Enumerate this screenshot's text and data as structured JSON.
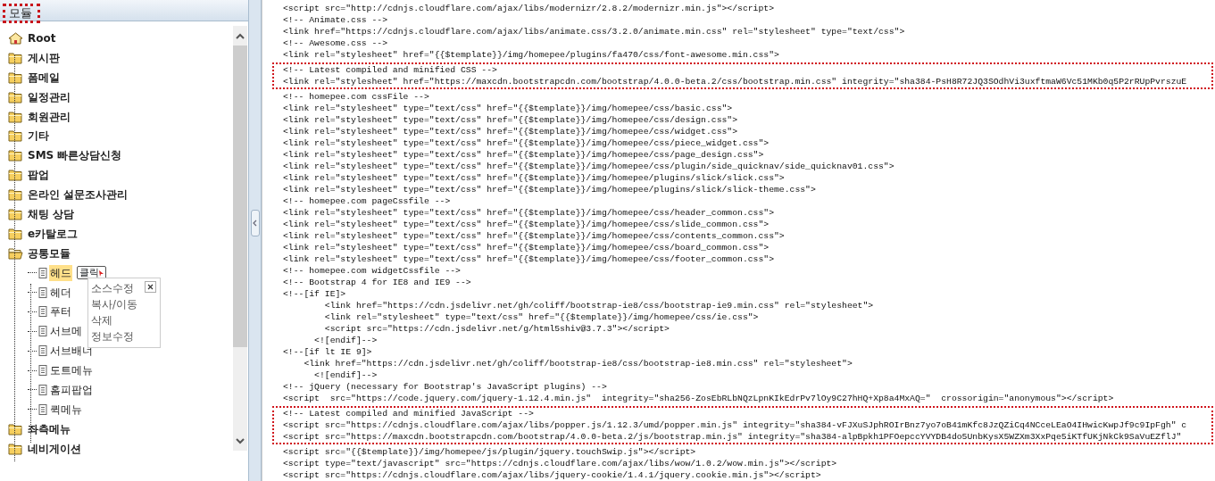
{
  "panel": {
    "title": "모듈",
    "highlighted": true
  },
  "tree": [
    {
      "label": "Root",
      "kind": "root",
      "selected": false
    },
    {
      "label": "게시판",
      "kind": "folder",
      "expanded": false,
      "selected": false
    },
    {
      "label": "폼메일",
      "kind": "folder",
      "expanded": false,
      "selected": false
    },
    {
      "label": "일정관리",
      "kind": "folder",
      "expanded": false,
      "selected": false
    },
    {
      "label": "회원관리",
      "kind": "folder",
      "expanded": false,
      "selected": false
    },
    {
      "label": "기타",
      "kind": "folder",
      "expanded": false,
      "selected": false
    },
    {
      "label": "SMS 빠른상담신청",
      "kind": "folder",
      "expanded": false,
      "selected": false
    },
    {
      "label": "팝업",
      "kind": "folder",
      "expanded": false,
      "selected": false
    },
    {
      "label": "온라인 설문조사관리",
      "kind": "folder",
      "expanded": false,
      "selected": false
    },
    {
      "label": "채팅 상담",
      "kind": "folder",
      "expanded": false,
      "selected": false
    },
    {
      "label": "e카탈로그",
      "kind": "folder",
      "expanded": false,
      "selected": false
    },
    {
      "label": "공통모듈",
      "kind": "folder",
      "expanded": true,
      "selected": false,
      "children": [
        {
          "label": "헤드",
          "kind": "page",
          "selected": true,
          "callout": "클릭"
        },
        {
          "label": "헤더",
          "kind": "page",
          "selected": false
        },
        {
          "label": "푸터",
          "kind": "page",
          "selected": false
        },
        {
          "label": "서브메",
          "kind": "page",
          "selected": false
        },
        {
          "label": "서브배너",
          "kind": "page",
          "selected": false
        },
        {
          "label": "도트메뉴",
          "kind": "page",
          "selected": false
        },
        {
          "label": "홈피팝업",
          "kind": "page",
          "selected": false
        },
        {
          "label": "퀵메뉴",
          "kind": "page",
          "selected": false
        }
      ]
    },
    {
      "label": "좌측메뉴",
      "kind": "folder",
      "expanded": false,
      "selected": false
    },
    {
      "label": "네비게이션",
      "kind": "folder",
      "expanded": false,
      "selected": false
    }
  ],
  "context_menu": {
    "items": [
      "소스수정",
      "복사/이동",
      "삭제",
      "정보수정"
    ]
  },
  "code": {
    "blocks": [
      {
        "highlighted": false,
        "lines": [
          "<script src=\"http://cdnjs.cloudflare.com/ajax/libs/modernizr/2.8.2/modernizr.min.js\"></script>",
          "<!-- Animate.css -->",
          "<link href=\"https://cdnjs.cloudflare.com/ajax/libs/animate.css/3.2.0/animate.min.css\" rel=\"stylesheet\" type=\"text/css\">",
          "<!-- Awesome.css -->",
          "<link rel=\"stylesheet\" href=\"{{$template}}/img/homepee/plugins/fa470/css/font-awesome.min.css\">"
        ]
      },
      {
        "highlighted": true,
        "lines": [
          "<!-- Latest compiled and minified CSS -->",
          "<link rel=\"stylesheet\" href=\"https://maxcdn.bootstrapcdn.com/bootstrap/4.0.0-beta.2/css/bootstrap.min.css\" integrity=\"sha384-PsH8R72JQ3SOdhVi3uxftmaW6Vc51MKb0q5P2rRUpPvrszuE"
        ]
      },
      {
        "highlighted": false,
        "lines": [
          "<!-- homepee.com cssFile -->",
          "<link rel=\"stylesheet\" type=\"text/css\" href=\"{{$template}}/img/homepee/css/basic.css\">",
          "<link rel=\"stylesheet\" type=\"text/css\" href=\"{{$template}}/img/homepee/css/design.css\">",
          "<link rel=\"stylesheet\" type=\"text/css\" href=\"{{$template}}/img/homepee/css/widget.css\">",
          "<link rel=\"stylesheet\" type=\"text/css\" href=\"{{$template}}/img/homepee/css/piece_widget.css\">",
          "<link rel=\"stylesheet\" type=\"text/css\" href=\"{{$template}}/img/homepee/css/page_design.css\">",
          "<link rel=\"stylesheet\" type=\"text/css\" href=\"{{$template}}/img/homepee/css/plugin/side_quicknav/side_quicknav01.css\">",
          "<link rel=\"stylesheet\" type=\"text/css\" href=\"{{$template}}/img/homepee/plugins/slick/slick.css\">",
          "<link rel=\"stylesheet\" type=\"text/css\" href=\"{{$template}}/img/homepee/plugins/slick/slick-theme.css\">",
          "<!-- homepee.com pageCssfile -->",
          "<link rel=\"stylesheet\" type=\"text/css\" href=\"{{$template}}/img/homepee/css/header_common.css\">",
          "<link rel=\"stylesheet\" type=\"text/css\" href=\"{{$template}}/img/homepee/css/slide_common.css\">",
          "<link rel=\"stylesheet\" type=\"text/css\" href=\"{{$template}}/img/homepee/css/contents_common.css\">",
          "<link rel=\"stylesheet\" type=\"text/css\" href=\"{{$template}}/img/homepee/css/board_common.css\">",
          "<link rel=\"stylesheet\" type=\"text/css\" href=\"{{$template}}/img/homepee/css/footer_common.css\">",
          "<!-- homepee.com widgetCssfile -->",
          "<!-- Bootstrap 4 for IE8 and IE9 -->",
          "<!--[if IE]>",
          "        <link href=\"https://cdn.jsdelivr.net/gh/coliff/bootstrap-ie8/css/bootstrap-ie9.min.css\" rel=\"stylesheet\">",
          "        <link rel=\"stylesheet\" type=\"text/css\" href=\"{{$template}}/img/homepee/css/ie.css\">",
          "        <script src=\"https://cdn.jsdelivr.net/g/html5shiv@3.7.3\"></script>",
          "      <![endif]-->",
          "<!--[if lt IE 9]>",
          "    <link href=\"https://cdn.jsdelivr.net/gh/coliff/bootstrap-ie8/css/bootstrap-ie8.min.css\" rel=\"stylesheet\">",
          "      <![endif]-->",
          "<!-- jQuery (necessary for Bootstrap's JavaScript plugins) -->",
          "<script  src=\"https://code.jquery.com/jquery-1.12.4.min.js\"  integrity=\"sha256-ZosEbRLbNQzLpnKIkEdrPv7lOy9C27hHQ+Xp8a4MxAQ=\"  crossorigin=\"anonymous\"></script>"
        ]
      },
      {
        "highlighted": true,
        "lines": [
          "<!-- Latest compiled and minified JavaScript -->",
          "<script src=\"https://cdnjs.cloudflare.com/ajax/libs/popper.js/1.12.3/umd/popper.min.js\" integrity=\"sha384-vFJXuSJphROIrBnz7yo7oB41mKfc8JzQZiCq4NCceLEaO4IHwicKwpJf9c9IpFgh\" c",
          "<script src=\"https://maxcdn.bootstrapcdn.com/bootstrap/4.0.0-beta.2/js/bootstrap.min.js\" integrity=\"sha384-alpBpkh1PFOepccYVYDB4do5UnbKysX5WZXm3XxPqe5iKTfUKjNkCk9SaVuEZflJ\""
        ]
      },
      {
        "highlighted": false,
        "lines": [
          "<script src=\"{{$template}}/img/homepee/js/plugin/jquery.touchSwip.js\"></script>",
          "<script type=\"text/javascript\" src=\"https://cdnjs.cloudflare.com/ajax/libs/wow/1.0.2/wow.min.js\"></script>",
          "<script src=\"https://cdnjs.cloudflare.com/ajax/libs/jquery-cookie/1.4.1/jquery.cookie.min.js\"></script>"
        ]
      }
    ]
  }
}
